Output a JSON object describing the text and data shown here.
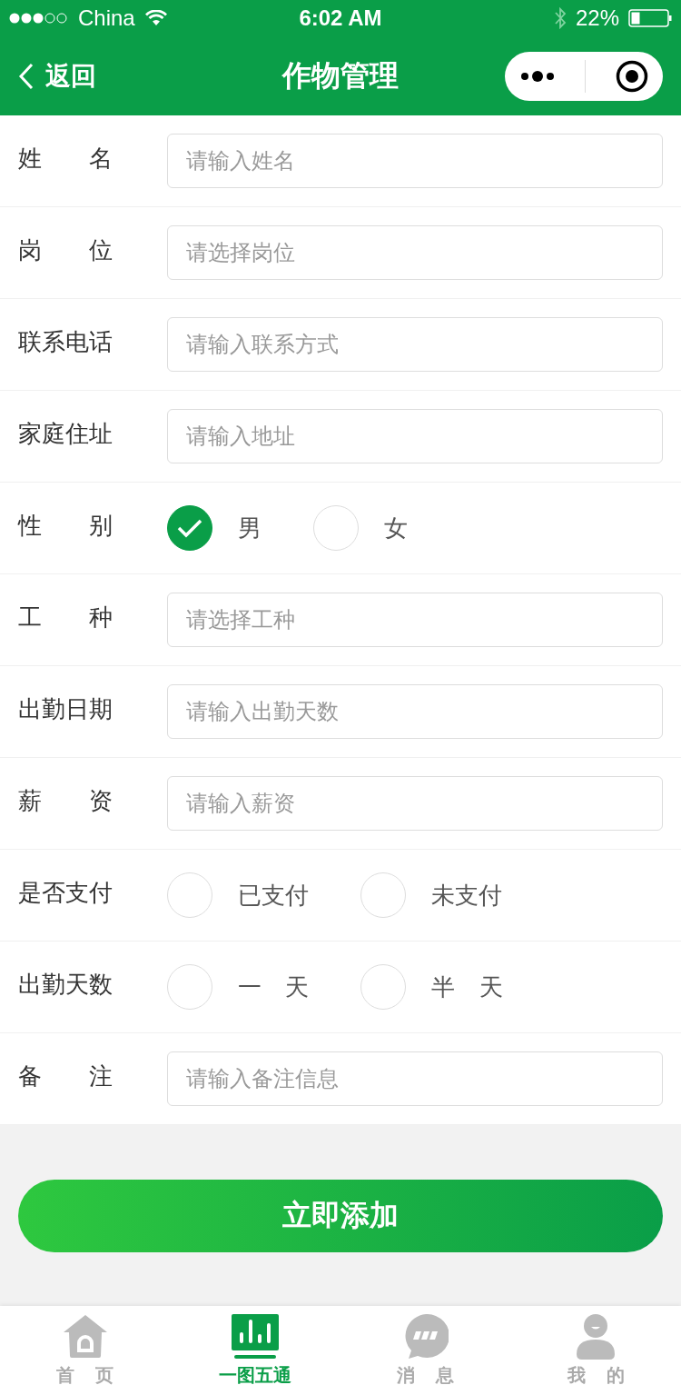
{
  "status_bar": {
    "carrier": "China",
    "time": "6:02 AM",
    "battery": "22%"
  },
  "nav": {
    "back": "返回",
    "title": "作物管理"
  },
  "form": [
    {
      "kind": "input",
      "label": "姓 名",
      "placeholder": "请输入姓名"
    },
    {
      "kind": "input",
      "label": "岗 位",
      "placeholder": "请选择岗位"
    },
    {
      "kind": "input",
      "label": "联系电话",
      "placeholder": "请输入联系方式"
    },
    {
      "kind": "input",
      "label": "家庭住址",
      "placeholder": "请输入地址"
    },
    {
      "kind": "radio",
      "label": "性 别",
      "options": [
        {
          "label": "男",
          "selected": true
        },
        {
          "label": "女",
          "selected": false
        }
      ]
    },
    {
      "kind": "input",
      "label": "工 种",
      "placeholder": "请选择工种"
    },
    {
      "kind": "input",
      "label": "出勤日期",
      "placeholder": "请输入出勤天数"
    },
    {
      "kind": "input",
      "label": "薪 资",
      "placeholder": "请输入薪资"
    },
    {
      "kind": "radio",
      "label": "是否支付",
      "options": [
        {
          "label": "已支付",
          "selected": false
        },
        {
          "label": "未支付",
          "selected": false
        }
      ]
    },
    {
      "kind": "radio",
      "label": "出勤天数",
      "options": [
        {
          "label": "一 天",
          "selected": false
        },
        {
          "label": "半 天",
          "selected": false
        }
      ]
    },
    {
      "kind": "input",
      "label": "备 注",
      "placeholder": "请输入备注信息"
    }
  ],
  "submit": "立即添加",
  "tabs": [
    {
      "kind": "home",
      "label": "首 页",
      "selected": false
    },
    {
      "kind": "chart",
      "label": "一图五通",
      "selected": true
    },
    {
      "kind": "chat",
      "label": "消 息",
      "selected": false
    },
    {
      "kind": "user",
      "label": "我 的",
      "selected": false
    }
  ]
}
